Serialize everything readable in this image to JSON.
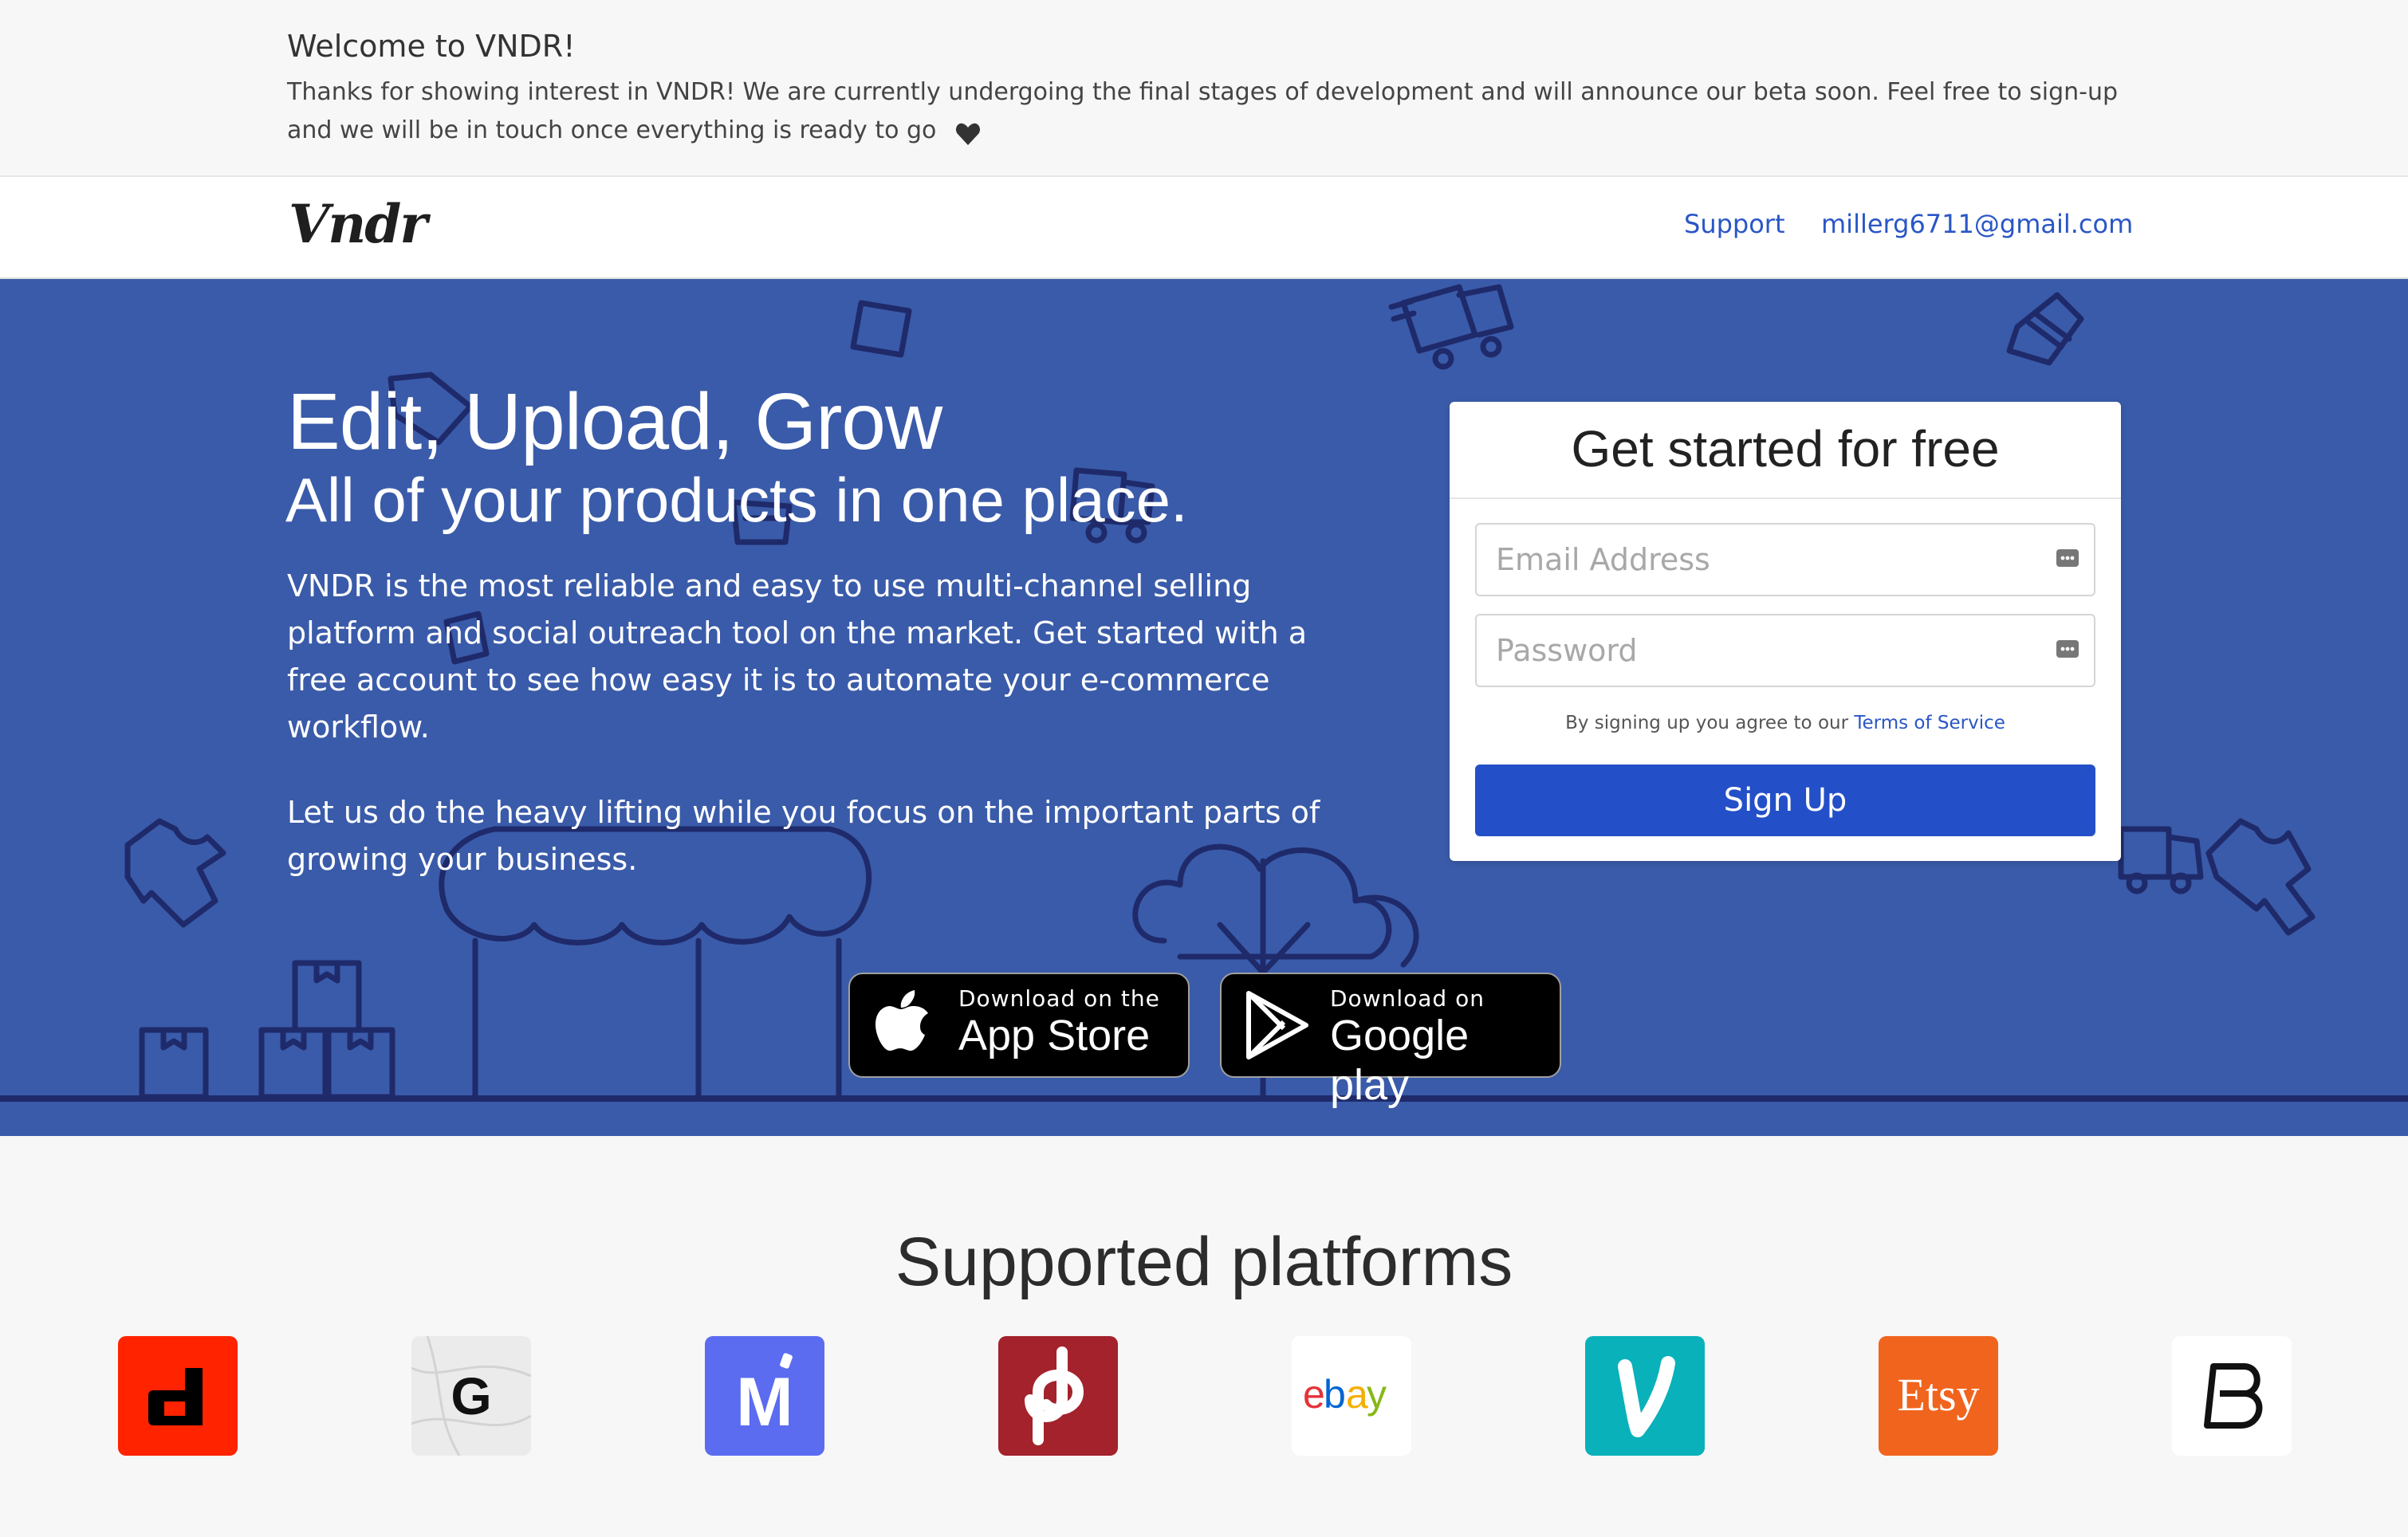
{
  "announcement": {
    "title": "Welcome to VNDR!",
    "body": "Thanks for showing interest in VNDR! We are currently undergoing the final stages of development and will announce our beta soon. Feel free to sign-up and we will be in touch once everything is ready to go"
  },
  "navbar": {
    "logo": "Vndr",
    "support": "Support",
    "email": "millerg6711@gmail.com"
  },
  "hero": {
    "title": "Edit, Upload, Grow",
    "subtitle": "All of your products in one place.",
    "paragraph1": "VNDR is the most reliable and easy to use multi-channel selling platform and social outreach tool on the market. Get started with a free account to see how easy it is to automate your e-commerce workflow.",
    "paragraph2": "Let us do the heavy lifting while you focus on the important parts of growing your business.",
    "app_store": {
      "small": "Download on the",
      "big": "App Store"
    },
    "google_play": {
      "small": "Download on",
      "big": "Google play"
    }
  },
  "signup": {
    "title": "Get started for free",
    "email_placeholder": "Email Address",
    "password_placeholder": "Password",
    "terms_prefix": "By signing up you agree to our",
    "terms_link": "Terms of Service",
    "button": "Sign Up"
  },
  "platforms": {
    "title": "Supported platforms",
    "items": [
      {
        "name": "depop",
        "letter": "d",
        "color": "#ff2300"
      },
      {
        "name": "grailed",
        "letter": "G",
        "color": "#e9e9e9"
      },
      {
        "name": "mercari",
        "letter": "M",
        "color": "#5b6cf0"
      },
      {
        "name": "poshmark",
        "letter": "P",
        "color": "#a3222c"
      },
      {
        "name": "ebay",
        "letter": "ebay",
        "color": "#ffffff"
      },
      {
        "name": "vinted",
        "letter": "V",
        "color": "#09b1ba"
      },
      {
        "name": "etsy",
        "letter": "Etsy",
        "color": "#f1641e"
      },
      {
        "name": "bonanza",
        "letter": "B",
        "color": "#ffffff"
      }
    ]
  },
  "colors": {
    "hero_bg": "#3a5ba9",
    "link": "#2a56c6",
    "button": "#2350c8",
    "line_art": "#1f2a6b"
  }
}
